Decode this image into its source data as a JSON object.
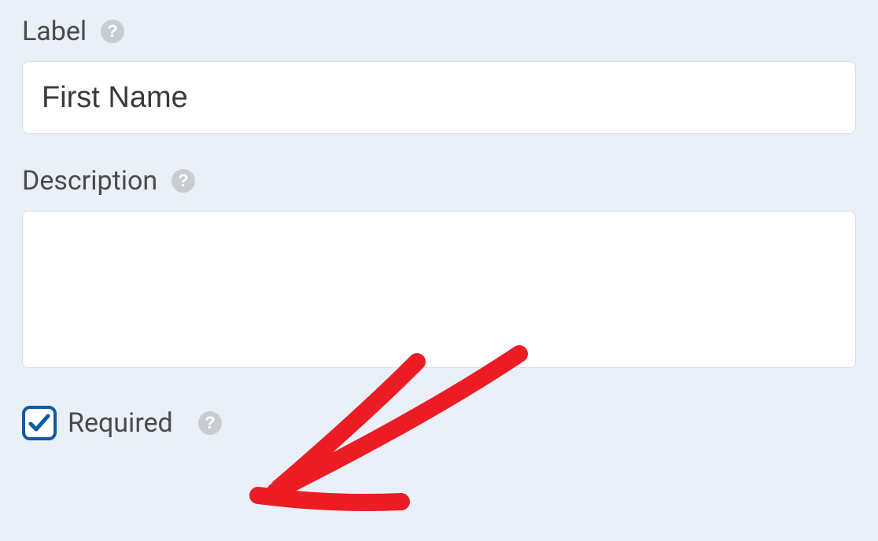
{
  "fields": {
    "label": {
      "caption": "Label",
      "value": "First Name"
    },
    "description": {
      "caption": "Description",
      "value": ""
    },
    "required": {
      "caption": "Required",
      "checked": true
    }
  },
  "colors": {
    "accent": "#0d5aa7",
    "annotation": "#ed1c24",
    "help_icon": "#c9ccd1"
  }
}
